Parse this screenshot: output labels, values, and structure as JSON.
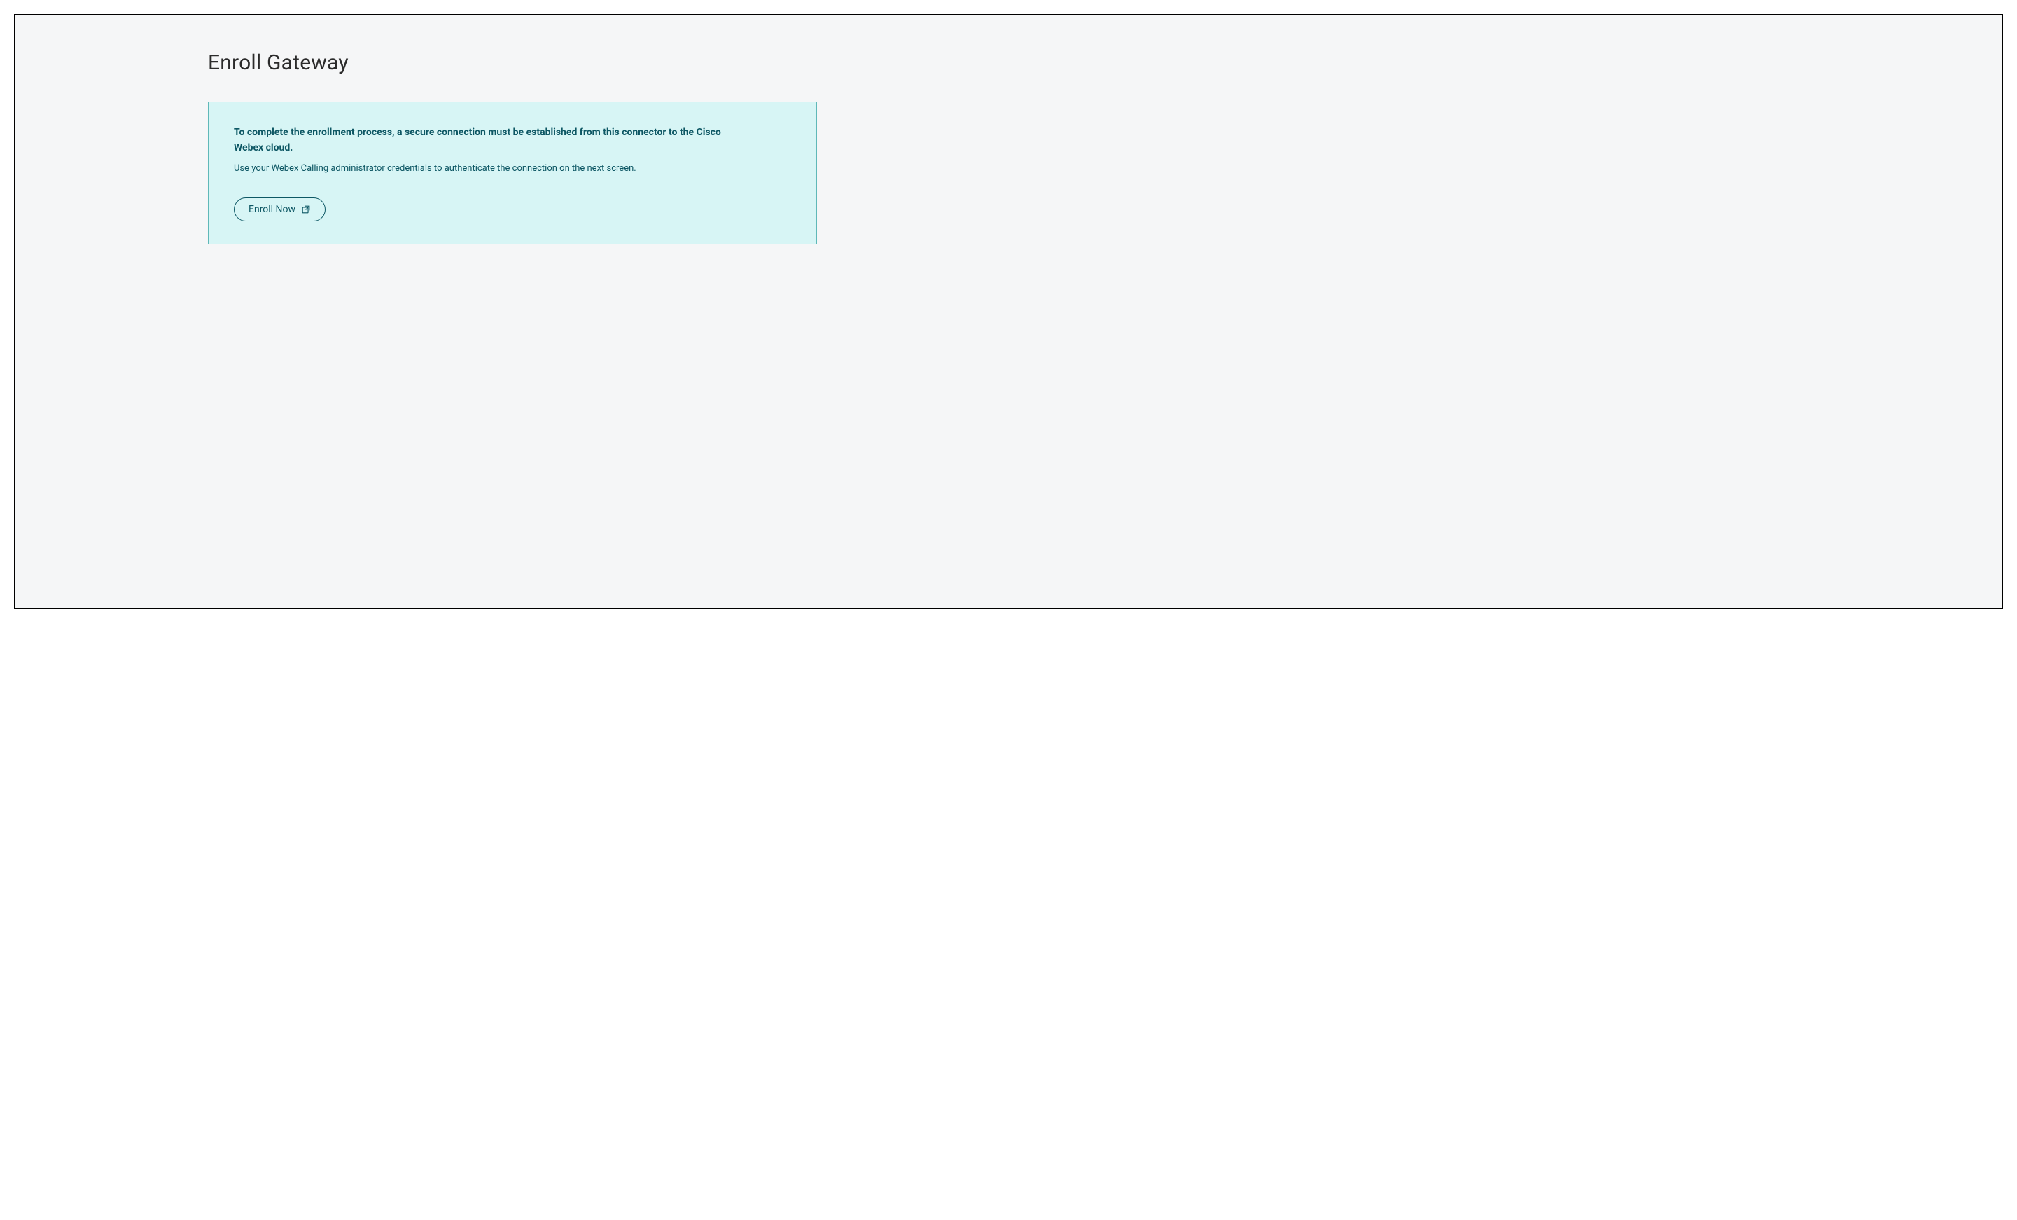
{
  "page": {
    "title": "Enroll Gateway"
  },
  "info_panel": {
    "heading": "To complete the enrollment process, a secure connection must be established from this connector to the Cisco Webex cloud.",
    "description": "Use your Webex Calling administrator credentials to authenticate the connection on the next screen.",
    "button_label": "Enroll Now"
  },
  "colors": {
    "page_background": "#f5f6f7",
    "panel_background": "#d7f5f5",
    "panel_border": "#5fb8b8",
    "text_primary": "#0d5764",
    "title_color": "#2b2b2b"
  }
}
